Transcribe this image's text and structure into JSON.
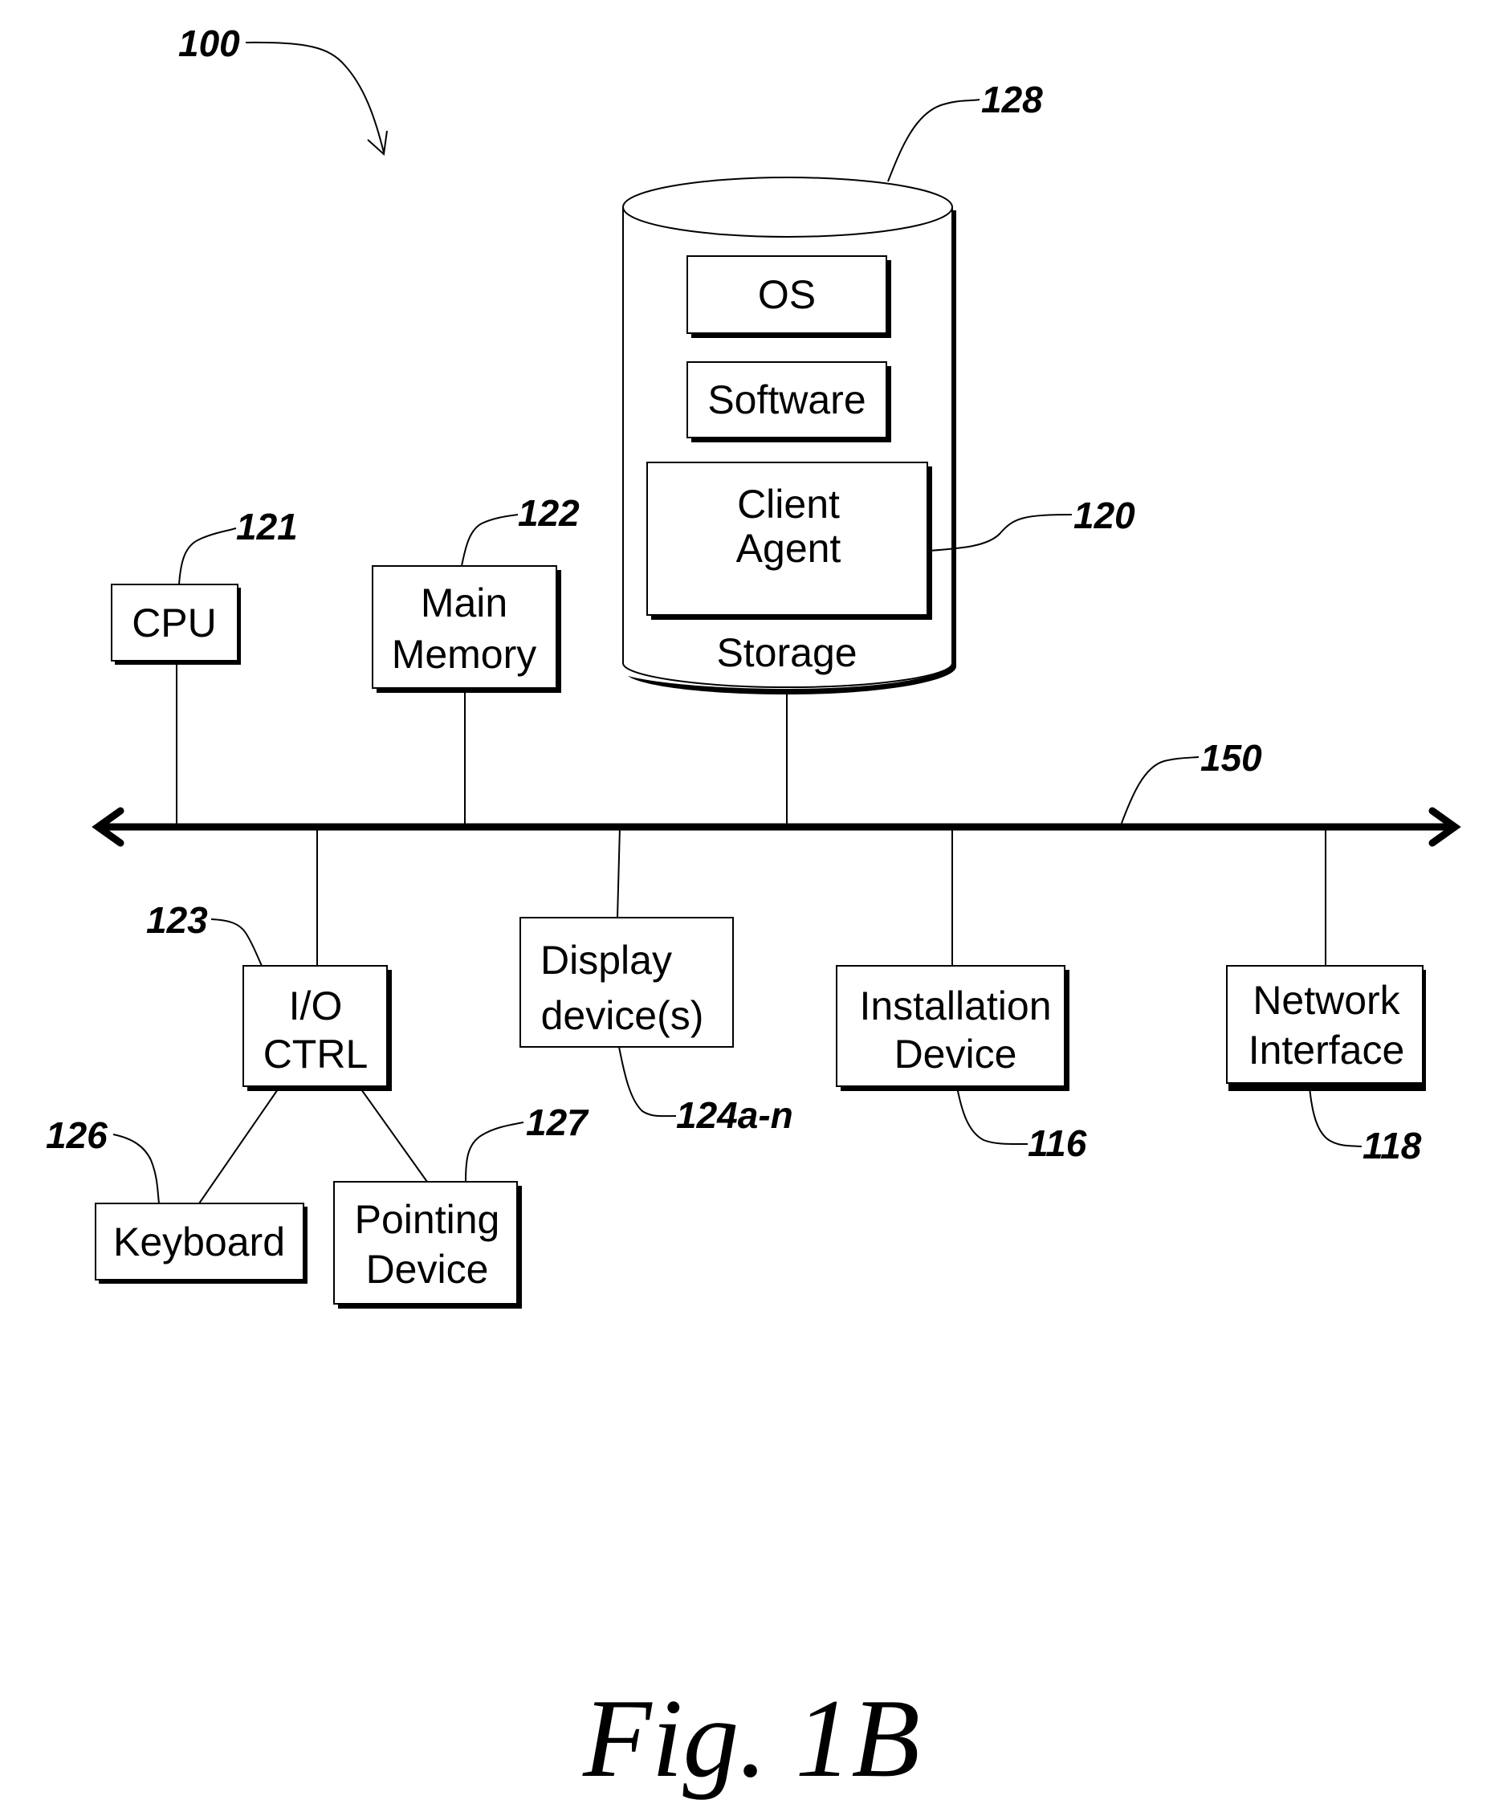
{
  "figure": {
    "caption": "Fig. 1B",
    "reference": "100"
  },
  "storage": {
    "label": "Storage",
    "reference": "128",
    "contents": {
      "os": "OS",
      "software": "Software",
      "client_agent_line1": "Client",
      "client_agent_line2": "Agent",
      "client_agent_reference": "120"
    }
  },
  "bus": {
    "reference": "150"
  },
  "components": {
    "cpu": {
      "label": "CPU",
      "reference": "121"
    },
    "main_memory": {
      "line1": "Main",
      "line2": "Memory",
      "reference": "122"
    },
    "io_ctrl": {
      "line1": "I/O",
      "line2": "CTRL",
      "reference": "123"
    },
    "display": {
      "line1": "Display",
      "line2": "device(s)",
      "reference": "124a-n"
    },
    "installation": {
      "line1": "Installation",
      "line2": "Device",
      "reference": "116"
    },
    "network": {
      "line1": "Network",
      "line2": "Interface",
      "reference": "118"
    },
    "keyboard": {
      "label": "Keyboard",
      "reference": "126"
    },
    "pointing": {
      "line1": "Pointing",
      "line2": "Device",
      "reference": "127"
    }
  }
}
